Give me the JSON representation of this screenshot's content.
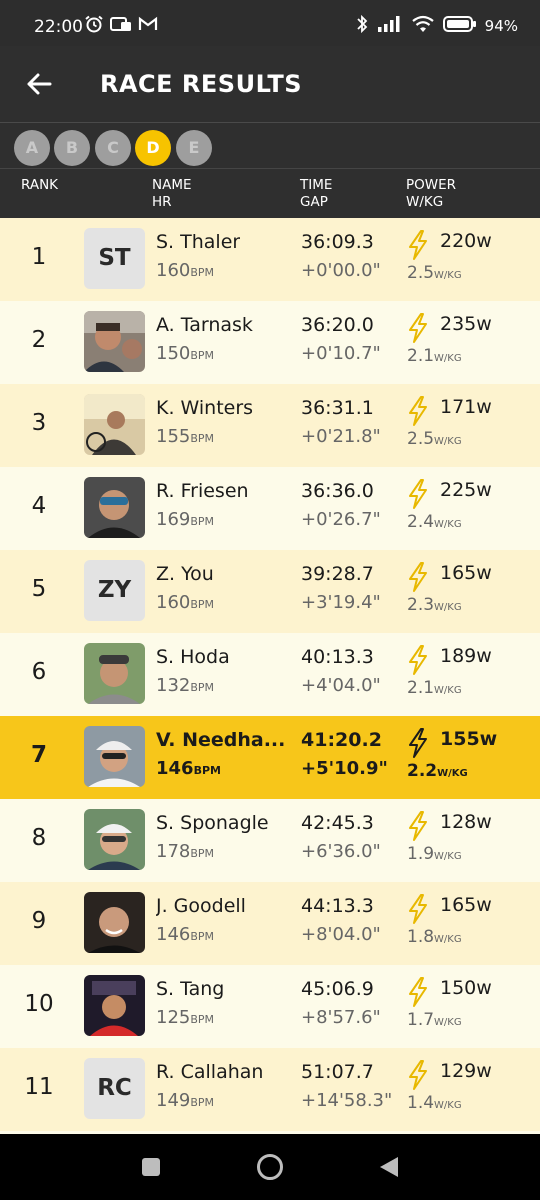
{
  "status_bar": {
    "time": "22:00",
    "battery": "94%",
    "left_icons": [
      "alarm-icon",
      "notification-icon",
      "gmail-icon"
    ],
    "right_icons": [
      "bluetooth-icon",
      "signal-icon",
      "wifi-icon",
      "battery-icon"
    ]
  },
  "header": {
    "title": "RACE RESULTS",
    "back_icon": "arrow-left-icon"
  },
  "categories": [
    "A",
    "B",
    "C",
    "D",
    "E"
  ],
  "active_category": "D",
  "columns": {
    "rank": "RANK",
    "name": "NAME",
    "hr": "HR",
    "time": "TIME",
    "gap": "GAP",
    "power": "POWER",
    "wkg": "W/KG"
  },
  "units": {
    "bpm": "BPM",
    "wkg": "W/KG"
  },
  "rows": [
    {
      "rank": "1",
      "initials": "ST",
      "name": "S. Thaler",
      "hr": "160",
      "time": "36:09.3",
      "gap": "+0'00.0\"",
      "power": "220w",
      "wkg": "2.5"
    },
    {
      "rank": "2",
      "initials": "",
      "name": "A. Tarnask",
      "hr": "150",
      "time": "36:20.0",
      "gap": "+0'10.7\"",
      "power": "235w",
      "wkg": "2.1"
    },
    {
      "rank": "3",
      "initials": "",
      "name": "K. Winters",
      "hr": "155",
      "time": "36:31.1",
      "gap": "+0'21.8\"",
      "power": "171w",
      "wkg": "2.5"
    },
    {
      "rank": "4",
      "initials": "",
      "name": "R. Friesen",
      "hr": "169",
      "time": "36:36.0",
      "gap": "+0'26.7\"",
      "power": "225w",
      "wkg": "2.4"
    },
    {
      "rank": "5",
      "initials": "ZY",
      "name": "Z. You",
      "hr": "160",
      "time": "39:28.7",
      "gap": "+3'19.4\"",
      "power": "165w",
      "wkg": "2.3"
    },
    {
      "rank": "6",
      "initials": "",
      "name": "S. Hoda",
      "hr": "132",
      "time": "40:13.3",
      "gap": "+4'04.0\"",
      "power": "189w",
      "wkg": "2.1"
    },
    {
      "rank": "7",
      "initials": "",
      "name": "V. Needha...",
      "hr": "146",
      "time": "41:20.2",
      "gap": "+5'10.9\"",
      "power": "155w",
      "wkg": "2.2",
      "highlight": true
    },
    {
      "rank": "8",
      "initials": "",
      "name": "S. Sponagle",
      "hr": "178",
      "time": "42:45.3",
      "gap": "+6'36.0\"",
      "power": "128w",
      "wkg": "1.9"
    },
    {
      "rank": "9",
      "initials": "",
      "name": "J. Goodell",
      "hr": "146",
      "time": "44:13.3",
      "gap": "+8'04.0\"",
      "power": "165w",
      "wkg": "1.8"
    },
    {
      "rank": "10",
      "initials": "",
      "name": "S. Tang",
      "hr": "125",
      "time": "45:06.9",
      "gap": "+8'57.6\"",
      "power": "150w",
      "wkg": "1.7"
    },
    {
      "rank": "11",
      "initials": "RC",
      "name": "R. Callahan",
      "hr": "149",
      "time": "51:07.7",
      "gap": "+14'58.3\"",
      "power": "129w",
      "wkg": "1.4"
    }
  ],
  "colors": {
    "accent": "#f7c61a",
    "header_bg": "#2f2f2f",
    "row_a": "#fdf3cf",
    "row_b": "#fdfbe9",
    "bolt": "#e8b800"
  },
  "nav_bar": {
    "icons": [
      "recents-square-icon",
      "home-circle-icon",
      "back-triangle-icon"
    ]
  }
}
